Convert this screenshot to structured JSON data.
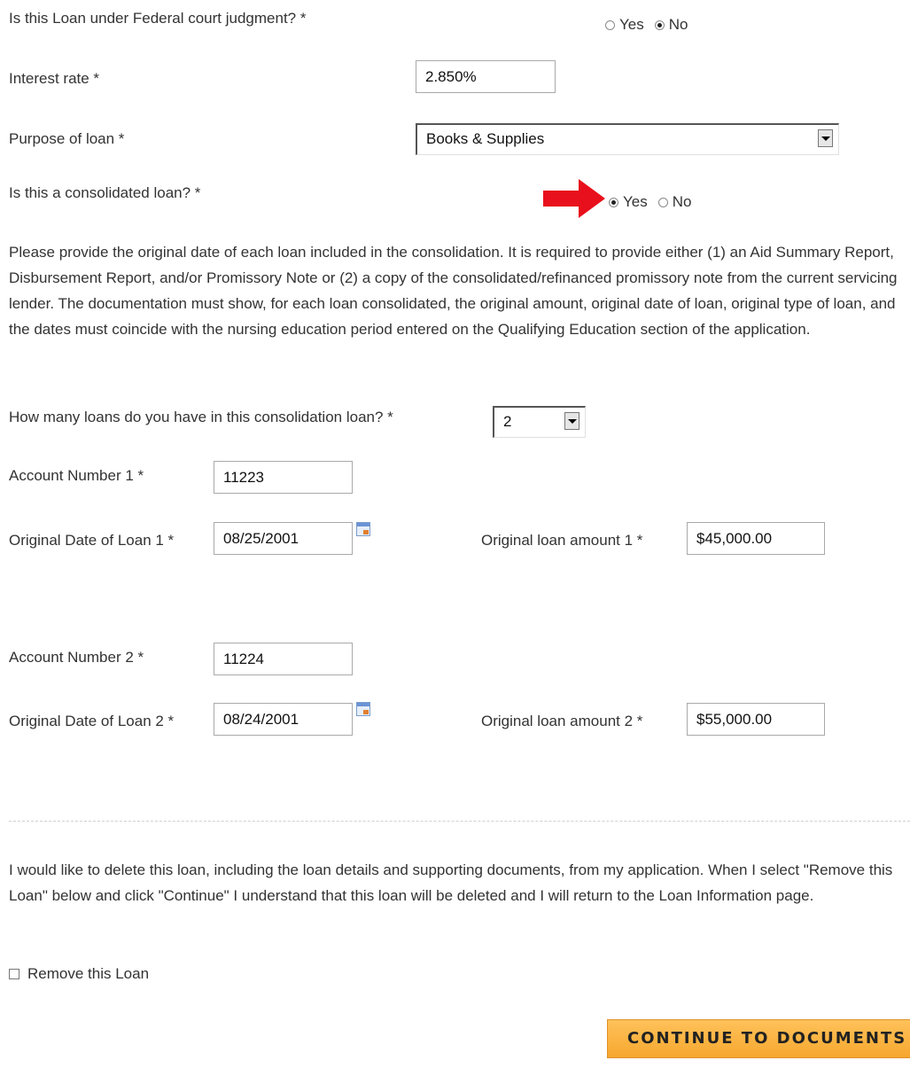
{
  "federal_judgment": {
    "question": "Is this Loan under Federal court judgment? *",
    "options": [
      "Yes",
      "No"
    ],
    "selected": "No"
  },
  "interest_rate": {
    "label": "Interest rate *",
    "value": "2.850%"
  },
  "purpose": {
    "label": "Purpose of loan *",
    "value": "Books & Supplies"
  },
  "consolidated": {
    "question": "Is this a consolidated loan? *",
    "options": [
      "Yes",
      "No"
    ],
    "selected": "Yes"
  },
  "consolidation_info": "Please provide the original date of each loan included in the consolidation. It is required to provide either (1) an Aid Summary Report, Disbursement Report, and/or Promissory Note or (2) a copy of the consolidated/refinanced promissory note from the current servicing lender. The documentation must show, for each loan consolidated, the original amount, original date of loan, original type of loan, and the dates must coincide with the nursing education period entered on the Qualifying Education section of the application.",
  "loan_count": {
    "label": "How many loans do you have in this consolidation loan? *",
    "value": "2"
  },
  "loans": [
    {
      "account_label": "Account Number 1 *",
      "account_value": "11223",
      "date_label": "Original Date of Loan 1 *",
      "date_value": "08/25/2001",
      "amount_label": "Original loan amount 1 *",
      "amount_value": "$45,000.00"
    },
    {
      "account_label": "Account Number 2 *",
      "account_value": "11224",
      "date_label": "Original Date of Loan 2 *",
      "date_value": "08/24/2001",
      "amount_label": "Original loan amount 2 *",
      "amount_value": "$55,000.00"
    }
  ],
  "delete_info": "I would like to delete this loan, including the loan details and supporting documents, from my application. When I select \"Remove this Loan\" below and click \"Continue\" I understand that this loan will be deleted and I will return to the Loan Information page.",
  "remove_loan": {
    "label": "Remove this Loan",
    "checked": false
  },
  "continue_button": "CONTINUE TO DOCUMENTS",
  "colors": {
    "annotation_arrow": "#e8101c",
    "button_fill": "#f8b040"
  }
}
